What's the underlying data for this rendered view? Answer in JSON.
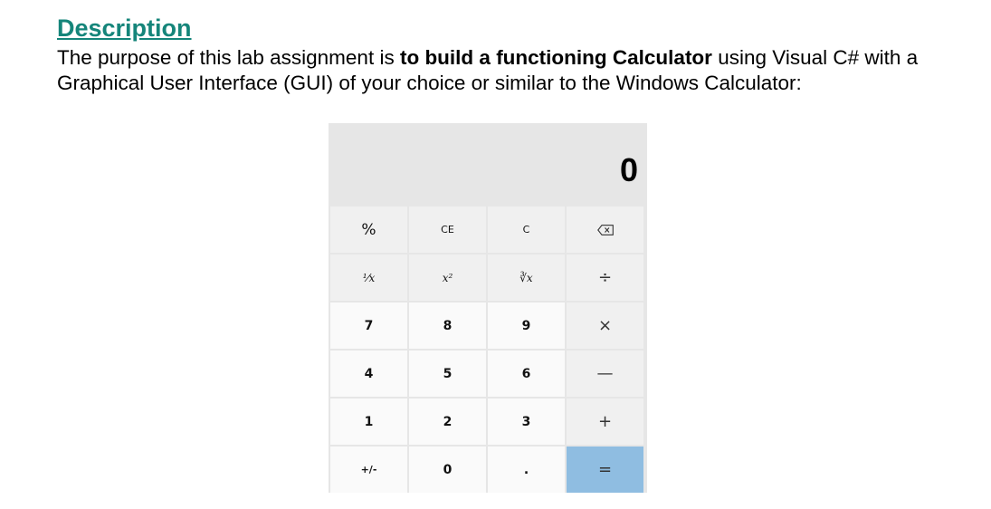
{
  "heading": "Description",
  "paragraph": {
    "before": "The purpose of this lab assignment is ",
    "bold": "to build a functioning Calculator",
    "after": " using Visual C# with a Graphical User Interface (GUI) of your choice or similar to the Windows Calculator:"
  },
  "calculator": {
    "display": "0",
    "keys": {
      "percent": "%",
      "ce": "CE",
      "clear": "C",
      "backspace": "⌫",
      "reciprocal": "⅟x",
      "square": "x²",
      "root": "∛x",
      "divide": "÷",
      "seven": "7",
      "eight": "8",
      "nine": "9",
      "multiply": "×",
      "four": "4",
      "five": "5",
      "six": "6",
      "minus": "—",
      "one": "1",
      "two": "2",
      "three": "3",
      "plus": "+",
      "negate": "+/-",
      "zero": "0",
      "decimal": ".",
      "equals": "="
    },
    "colors": {
      "body": "#e6e6e6",
      "function_key": "#f0f0f0",
      "number_key": "#fafafa",
      "equals_key": "#8fbde1"
    }
  }
}
